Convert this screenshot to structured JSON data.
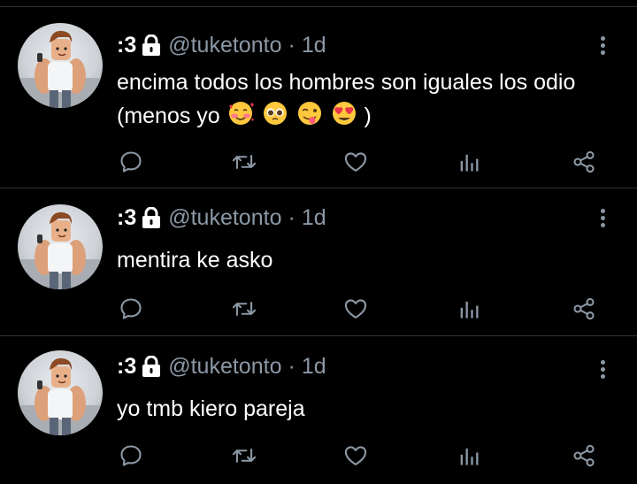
{
  "colors": {
    "background": "#000000",
    "text": "#ffffff",
    "secondary": "#8b98a5",
    "divider": "#2f3336"
  },
  "tweets": [
    {
      "display_name": ":3",
      "handle": "@tuketonto",
      "separator": "·",
      "time": "1d",
      "text_line1": "encima todos los hombres son iguales los odio",
      "text_line2_prefix": "(menos yo",
      "text_line2_suffix": ")",
      "emojis": [
        "smiling-face-with-hearts",
        "pleading-face",
        "zany-face",
        "heart-eyes"
      ]
    },
    {
      "display_name": ":3",
      "handle": "@tuketonto",
      "separator": "·",
      "time": "1d",
      "text_line1": "mentira ke asko"
    },
    {
      "display_name": ":3",
      "handle": "@tuketonto",
      "separator": "·",
      "time": "1d",
      "text_line1": "yo tmb kiero pareja"
    }
  ],
  "icons": {
    "reply": "comment-icon",
    "retweet": "retweet-icon",
    "like": "heart-icon",
    "views": "analytics-icon",
    "share": "share-icon",
    "more": "more-vertical-icon",
    "protected": "lock-icon"
  }
}
